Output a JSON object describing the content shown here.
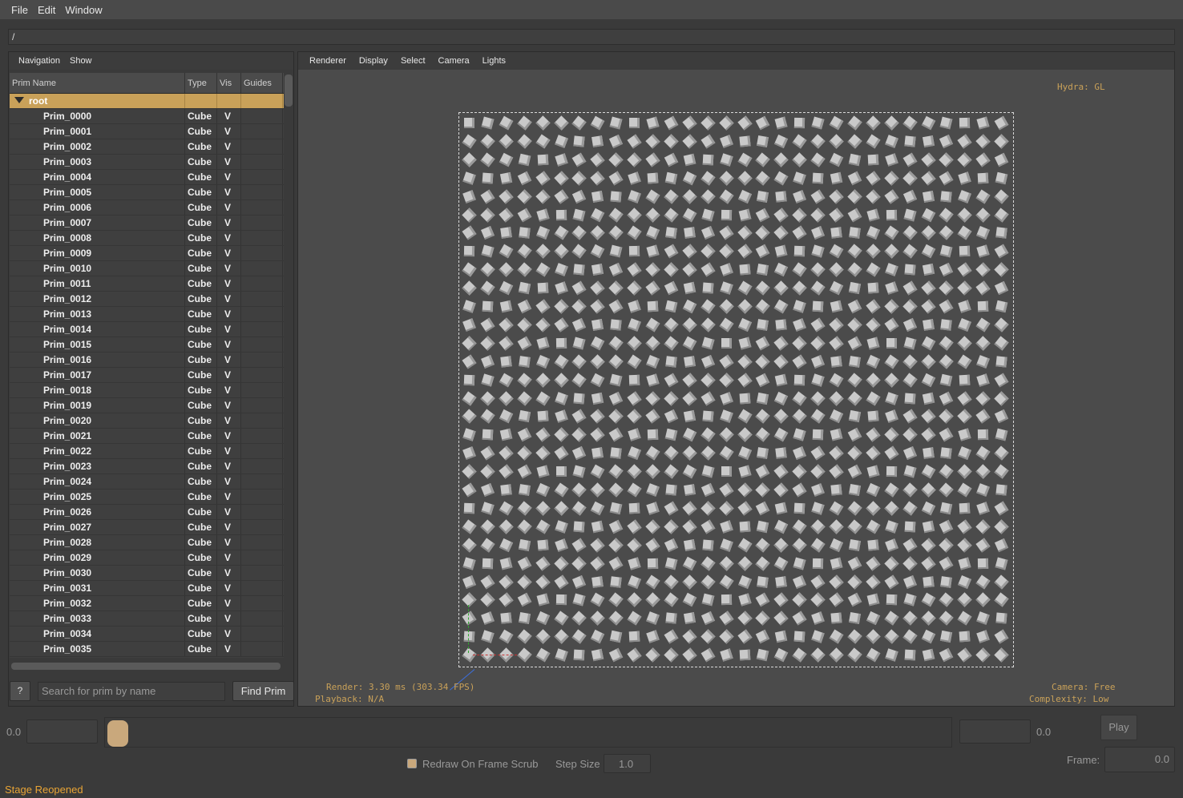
{
  "menubar": {
    "file": "File",
    "edit": "Edit",
    "window": "Window"
  },
  "path": "/",
  "left_menu": {
    "navigation": "Navigation",
    "show": "Show"
  },
  "tree": {
    "headers": {
      "name": "Prim Name",
      "type": "Type",
      "vis": "Vis",
      "guides": "Guides"
    },
    "root": "root",
    "rows": [
      {
        "name": "Prim_0000",
        "type": "Cube",
        "vis": "V"
      },
      {
        "name": "Prim_0001",
        "type": "Cube",
        "vis": "V"
      },
      {
        "name": "Prim_0002",
        "type": "Cube",
        "vis": "V"
      },
      {
        "name": "Prim_0003",
        "type": "Cube",
        "vis": "V"
      },
      {
        "name": "Prim_0004",
        "type": "Cube",
        "vis": "V"
      },
      {
        "name": "Prim_0005",
        "type": "Cube",
        "vis": "V"
      },
      {
        "name": "Prim_0006",
        "type": "Cube",
        "vis": "V"
      },
      {
        "name": "Prim_0007",
        "type": "Cube",
        "vis": "V"
      },
      {
        "name": "Prim_0008",
        "type": "Cube",
        "vis": "V"
      },
      {
        "name": "Prim_0009",
        "type": "Cube",
        "vis": "V"
      },
      {
        "name": "Prim_0010",
        "type": "Cube",
        "vis": "V"
      },
      {
        "name": "Prim_0011",
        "type": "Cube",
        "vis": "V"
      },
      {
        "name": "Prim_0012",
        "type": "Cube",
        "vis": "V"
      },
      {
        "name": "Prim_0013",
        "type": "Cube",
        "vis": "V"
      },
      {
        "name": "Prim_0014",
        "type": "Cube",
        "vis": "V"
      },
      {
        "name": "Prim_0015",
        "type": "Cube",
        "vis": "V"
      },
      {
        "name": "Prim_0016",
        "type": "Cube",
        "vis": "V"
      },
      {
        "name": "Prim_0017",
        "type": "Cube",
        "vis": "V"
      },
      {
        "name": "Prim_0018",
        "type": "Cube",
        "vis": "V"
      },
      {
        "name": "Prim_0019",
        "type": "Cube",
        "vis": "V"
      },
      {
        "name": "Prim_0020",
        "type": "Cube",
        "vis": "V"
      },
      {
        "name": "Prim_0021",
        "type": "Cube",
        "vis": "V"
      },
      {
        "name": "Prim_0022",
        "type": "Cube",
        "vis": "V"
      },
      {
        "name": "Prim_0023",
        "type": "Cube",
        "vis": "V"
      },
      {
        "name": "Prim_0024",
        "type": "Cube",
        "vis": "V"
      },
      {
        "name": "Prim_0025",
        "type": "Cube",
        "vis": "V"
      },
      {
        "name": "Prim_0026",
        "type": "Cube",
        "vis": "V"
      },
      {
        "name": "Prim_0027",
        "type": "Cube",
        "vis": "V"
      },
      {
        "name": "Prim_0028",
        "type": "Cube",
        "vis": "V"
      },
      {
        "name": "Prim_0029",
        "type": "Cube",
        "vis": "V"
      },
      {
        "name": "Prim_0030",
        "type": "Cube",
        "vis": "V"
      },
      {
        "name": "Prim_0031",
        "type": "Cube",
        "vis": "V"
      },
      {
        "name": "Prim_0032",
        "type": "Cube",
        "vis": "V"
      },
      {
        "name": "Prim_0033",
        "type": "Cube",
        "vis": "V"
      },
      {
        "name": "Prim_0034",
        "type": "Cube",
        "vis": "V"
      },
      {
        "name": "Prim_0035",
        "type": "Cube",
        "vis": "V"
      }
    ]
  },
  "search": {
    "help": "?",
    "placeholder": "Search for prim by name",
    "button": "Find Prim"
  },
  "viewport_menu": {
    "renderer": "Renderer",
    "display": "Display",
    "select": "Select",
    "camera": "Camera",
    "lights": "Lights"
  },
  "hud": {
    "hydra": "Hydra: GL",
    "render": "Render: 3.30 ms (303.34 FPS)",
    "playback": "Playback: N/A",
    "camera": "Camera: Free",
    "complexity": "Complexity: Low"
  },
  "timeline": {
    "start": "0.0",
    "end": "0.0",
    "play": "Play",
    "frame_label": "Frame:",
    "frame_value": "0.0",
    "redraw_label": "Redraw On Frame Scrub",
    "redraw_checked": true,
    "step_label": "Step Size",
    "step_value": "1.0"
  },
  "status": "Stage Reopened",
  "colors": {
    "accent": "#c9a159",
    "status": "#e8a435",
    "background": "#3a3a3a"
  }
}
